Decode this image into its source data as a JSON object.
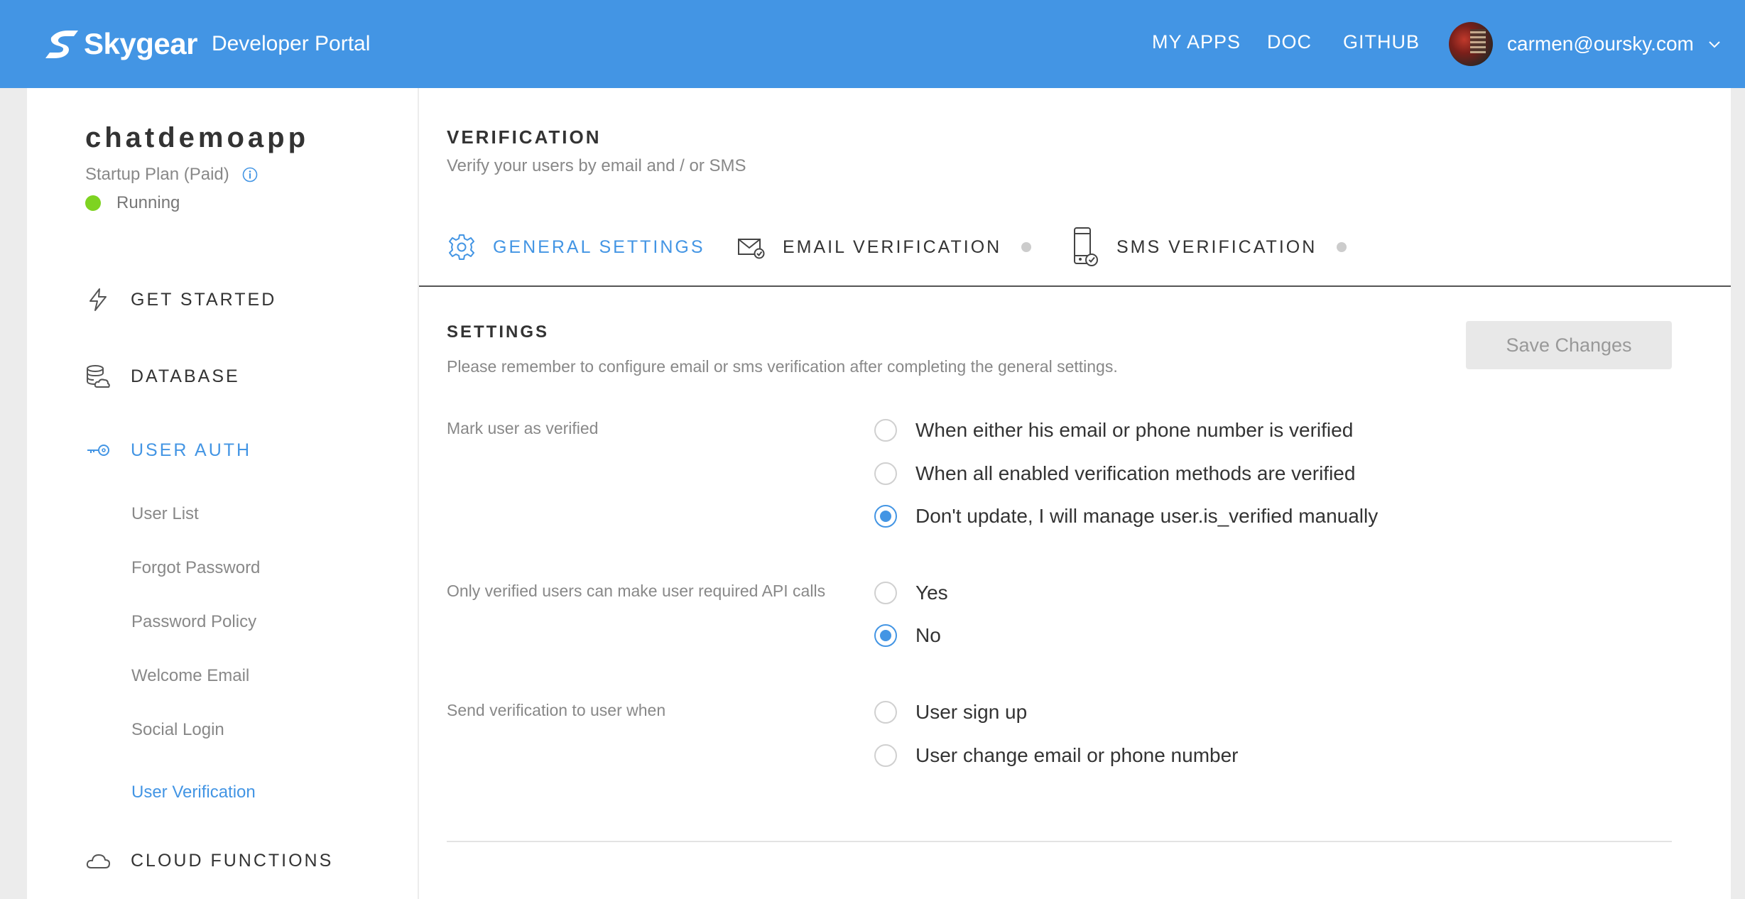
{
  "header": {
    "brand": "Skygear",
    "subtitle": "Developer Portal",
    "nav": [
      "MY APPS",
      "DOC",
      "GITHUB"
    ],
    "user_email": "carmen@oursky.com"
  },
  "sidebar": {
    "app_name": "chatdemoapp",
    "plan": "Startup Plan (Paid)",
    "status": "Running",
    "items": [
      {
        "label": "GET STARTED",
        "icon": "lightning-icon"
      },
      {
        "label": "DATABASE",
        "icon": "database-icon"
      },
      {
        "label": "USER AUTH",
        "icon": "key-icon",
        "active": true
      },
      {
        "label": "CLOUD FUNCTIONS",
        "icon": "cloud-icon"
      }
    ],
    "sub_items": [
      "User List",
      "Forgot Password",
      "Password Policy",
      "Welcome Email",
      "Social Login",
      "User Verification"
    ],
    "active_sub_item": "User Verification"
  },
  "main": {
    "title": "VERIFICATION",
    "subtitle": "Verify your users by email and / or SMS",
    "tabs": [
      {
        "label": "GENERAL SETTINGS",
        "icon": "gear-icon",
        "active": true
      },
      {
        "label": "EMAIL VERIFICATION",
        "icon": "envelope-check-icon"
      },
      {
        "label": "SMS VERIFICATION",
        "icon": "phone-check-icon"
      }
    ],
    "settings": {
      "title": "SETTINGS",
      "subtitle": "Please remember to configure email or sms verification after completing the general settings.",
      "save_label": "Save Changes",
      "fields": [
        {
          "label": "Mark user as verified",
          "options": [
            "When either his email or phone number is verified",
            "When all enabled verification methods are verified",
            "Don't update, I will manage user.is_verified manually"
          ],
          "selected": 2
        },
        {
          "label": "Only verified users can make user required API calls",
          "options": [
            "Yes",
            "No"
          ],
          "selected": 1
        },
        {
          "label": "Send verification to user when",
          "options": [
            "User sign up",
            "User change email or phone number"
          ],
          "selected": null
        }
      ]
    }
  },
  "colors": {
    "brand_blue": "#4395e4",
    "status_green": "#7ed321"
  }
}
